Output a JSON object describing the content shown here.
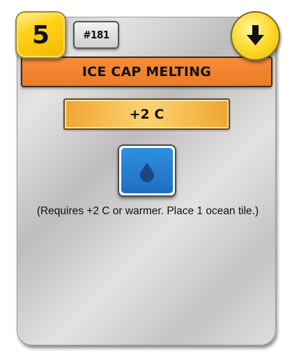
{
  "card": {
    "cost": "5",
    "number": "#181",
    "title": "ICE CAP MELTING",
    "requirement": "+2 C",
    "description": "(Requires +2 C or warmer. Place 1 ocean tile.)",
    "tag_icon": "event-arrow-down-icon",
    "effect_icon": "ocean-tile-icon"
  },
  "colors": {
    "title_bar": "#ee7a26",
    "cost_badge": "#ffd318",
    "requirement_box": "#f0a530",
    "ocean_tile": "#1f6fc3"
  }
}
